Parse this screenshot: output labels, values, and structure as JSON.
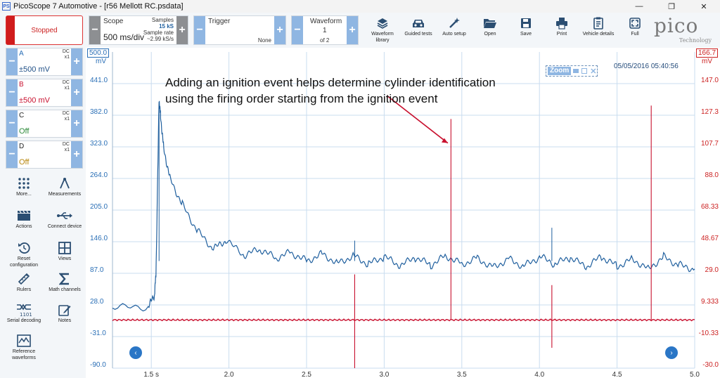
{
  "window": {
    "title": "PicoScope 7 Automotive - [r56 Mellott RC.psdata]",
    "app_icon": "PS",
    "minimize": "—",
    "maximize": "❐",
    "close": "✕"
  },
  "toolbar": {
    "run_state": "Stopped",
    "scope": {
      "label": "Scope",
      "timebase": "500 ms/div",
      "samples_label": "Samples",
      "samples_value": "15 kS",
      "rate_label": "Sample rate",
      "rate_value": "~2.99 kS/s"
    },
    "trigger": {
      "label": "Trigger",
      "mode": "None"
    },
    "waveform": {
      "label": "Waveform",
      "current": "1",
      "of": "of 2"
    },
    "buttons": [
      {
        "id": "waveform-library",
        "label": "Waveform library",
        "icon": "books-icon"
      },
      {
        "id": "guided-tests",
        "label": "Guided tests",
        "icon": "car-icon"
      },
      {
        "id": "auto-setup",
        "label": "Auto setup",
        "icon": "wand-icon"
      },
      {
        "id": "open",
        "label": "Open",
        "icon": "folder-icon"
      },
      {
        "id": "save",
        "label": "Save",
        "icon": "floppy-icon"
      },
      {
        "id": "print",
        "label": "Print",
        "icon": "printer-icon"
      },
      {
        "id": "vehicle-details",
        "label": "Vehicle details",
        "icon": "clipboard-icon"
      },
      {
        "id": "full",
        "label": "Full",
        "icon": "fullscreen-icon"
      }
    ],
    "logo": {
      "text": "pico",
      "sub": "Technology"
    }
  },
  "channels": [
    {
      "name": "A",
      "coupling": "DC",
      "probe": "x1",
      "range": "±500 mV",
      "color": "#2a6fb6"
    },
    {
      "name": "B",
      "coupling": "DC",
      "probe": "x1",
      "range": "±500 mV",
      "color": "#c8102e"
    },
    {
      "name": "C",
      "coupling": "DC",
      "probe": "x1",
      "range": "Off",
      "color": "#2e8b3a"
    },
    {
      "name": "D",
      "coupling": "DC",
      "probe": "x1",
      "range": "Off",
      "color": "#b8860b"
    }
  ],
  "left_tools": [
    {
      "id": "more",
      "label": "More...",
      "icon": "grid-dots-icon"
    },
    {
      "id": "measurements",
      "label": "Measurements",
      "icon": "compass-icon"
    },
    {
      "id": "actions",
      "label": "Actions",
      "icon": "clapper-icon"
    },
    {
      "id": "connect-device",
      "label": "Connect device",
      "icon": "usb-icon"
    },
    {
      "id": "reset-configuration",
      "label": "Reset configuration",
      "icon": "reset-icon"
    },
    {
      "id": "views",
      "label": "Views",
      "icon": "views-icon"
    },
    {
      "id": "rulers",
      "label": "Rulers",
      "icon": "ruler-icon"
    },
    {
      "id": "math-channels",
      "label": "Math channels",
      "icon": "sigma-icon"
    },
    {
      "id": "serial-decoding",
      "label": "Serial decoding",
      "icon": "serial-icon"
    },
    {
      "id": "notes",
      "label": "Notes",
      "icon": "notes-icon"
    },
    {
      "id": "reference-waveforms",
      "label": "Reference waveforms",
      "icon": "reference-icon"
    }
  ],
  "plot": {
    "annotation_line1": "Adding an ignition event helps determine cylinder identification",
    "annotation_line2": "using the firing order starting from the ignition event",
    "datetime": "05/05/2016 05:40:56",
    "zoom_label": "Zoom",
    "left_axis_top": "500.0",
    "left_unit": "mV",
    "right_axis_top": "166.7",
    "right_unit": "mV",
    "nav_left": "‹",
    "nav_right": "›",
    "colors": {
      "grid": "#c9dcef",
      "channel_a": "#1f5f9e",
      "channel_b": "#c8102e",
      "arrow": "#c8102e"
    }
  },
  "chart_data": {
    "type": "line",
    "x_range": [
      1.25,
      5.0
    ],
    "x_ticks": [
      "1.5 s",
      "2.0",
      "2.5",
      "3.0",
      "3.5",
      "4.0",
      "4.5",
      "5.0"
    ],
    "x_tick_values": [
      1.5,
      2.0,
      2.5,
      3.0,
      3.5,
      4.0,
      4.5,
      5.0
    ],
    "left_axis": {
      "ticks": [
        "441.0",
        "382.0",
        "323.0",
        "264.0",
        "205.0",
        "146.0",
        "87.0",
        "28.0",
        "-31.0",
        "-90.0"
      ],
      "values": [
        441,
        382,
        323,
        264,
        205,
        146,
        87,
        28,
        -31,
        -90
      ],
      "range": [
        -90,
        500
      ]
    },
    "right_axis": {
      "ticks": [
        "147.0",
        "127.3",
        "107.7",
        "88.0",
        "68.33",
        "48.67",
        "29.0",
        "9.333",
        "-10.33",
        "-30.0"
      ],
      "values": [
        147.0,
        127.3,
        107.7,
        88.0,
        68.33,
        48.67,
        29.0,
        9.333,
        -10.33,
        -30.0
      ],
      "range": [
        -30,
        166.7
      ]
    },
    "series": [
      {
        "channel": "A",
        "axis": "left",
        "x": [
          1.25,
          1.48,
          1.52,
          1.53,
          1.55,
          1.56,
          1.58,
          1.62,
          1.7,
          1.8,
          1.9,
          1.98,
          2.1,
          2.2,
          2.3,
          2.4,
          2.5,
          2.6,
          2.7,
          2.8,
          2.9,
          3.0,
          3.1,
          3.2,
          3.3,
          3.4,
          3.5,
          3.6,
          3.7,
          3.8,
          3.9,
          4.0,
          4.1,
          4.2,
          4.3,
          4.4,
          4.5,
          4.6,
          4.7,
          4.8,
          4.9,
          5.0
        ],
        "y": [
          22,
          24,
          45,
          85,
          412,
          380,
          320,
          265,
          215,
          165,
          132,
          148,
          120,
          132,
          115,
          126,
          110,
          124,
          106,
          120,
          104,
          118,
          100,
          116,
          102,
          120,
          104,
          116,
          98,
          114,
          100,
          118,
          104,
          116,
          98,
          118,
          100,
          114,
          96,
          118,
          102,
          95
        ],
        "spikes": [
          {
            "x": 1.55,
            "y": 395
          },
          {
            "x": 2.81,
            "y": 148
          },
          {
            "x": 4.08,
            "y": 172
          }
        ]
      },
      {
        "channel": "B",
        "axis": "left",
        "baseline": 0,
        "spikes": [
          {
            "x": 2.81,
            "y": -90
          },
          {
            "x": 2.81,
            "y": 85
          },
          {
            "x": 3.43,
            "y": 375
          },
          {
            "x": 4.08,
            "y": -52
          },
          {
            "x": 4.08,
            "y": 65
          },
          {
            "x": 4.72,
            "y": 400
          }
        ]
      }
    ]
  }
}
